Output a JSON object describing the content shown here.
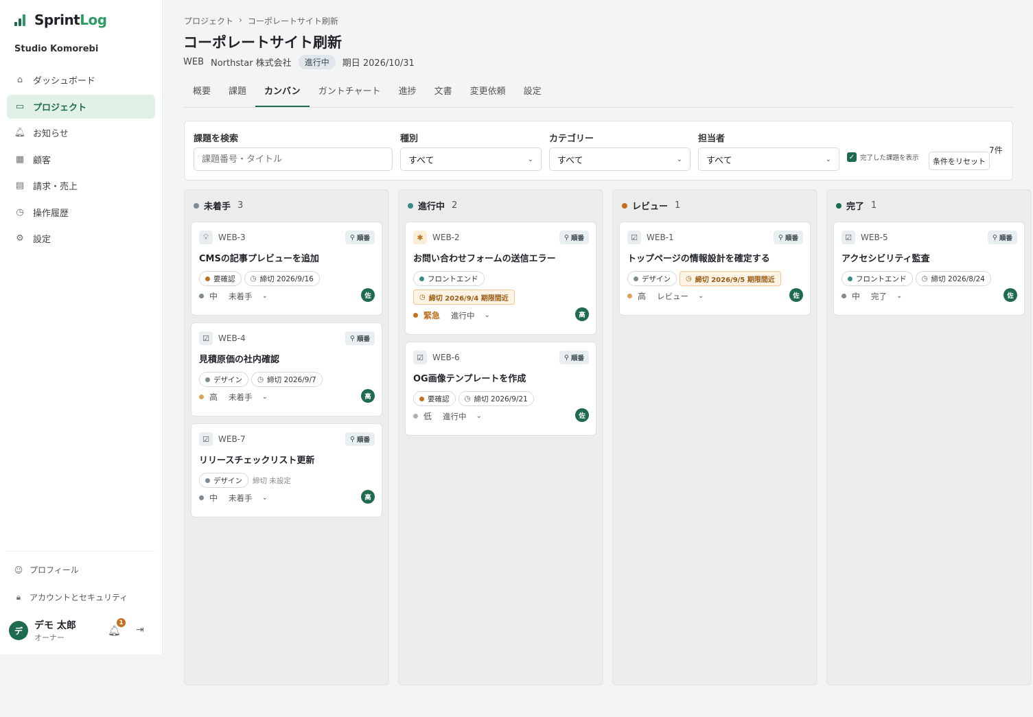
{
  "app": {
    "name_main": "Sprint",
    "name_accent": "Log",
    "org": "Studio Komorebi"
  },
  "colors": {
    "brand": "#1e6b4e",
    "warn": "#c0701f",
    "neutral": "#7d8a91"
  },
  "nav": [
    {
      "label": "ダッシュボード",
      "icon": "home-icon"
    },
    {
      "label": "プロジェクト",
      "icon": "folder-icon",
      "active": true
    },
    {
      "label": "お知らせ",
      "icon": "bell-icon"
    },
    {
      "label": "顧客",
      "icon": "building-icon"
    },
    {
      "label": "請求・売上",
      "icon": "receipt-icon"
    },
    {
      "label": "操作履歴",
      "icon": "clock-icon"
    },
    {
      "label": "設定",
      "icon": "gear-icon"
    }
  ],
  "sub_nav": {
    "profile": "プロフィール",
    "security": "アカウントとセキュリティ"
  },
  "user": {
    "initial": "デ",
    "name": "デモ 太郎",
    "role": "オーナー",
    "notifications": "1"
  },
  "breadcrumb": {
    "parent": "プロジェクト",
    "sep": "›",
    "current": "コーポレートサイト刷新"
  },
  "project": {
    "title": "コーポレートサイト刷新",
    "code": "WEB",
    "client": "Northstar 株式会社",
    "status": "進行中",
    "due": "期日 2026/10/31"
  },
  "tabs": [
    "概要",
    "課題",
    "カンバン",
    "ガントチャート",
    "進捗",
    "文書",
    "変更依頼",
    "設定"
  ],
  "filters": {
    "search_label": "課題を検索",
    "search_placeholder": "課題番号・タイトル",
    "type_label": "種別",
    "type_value": "すべて",
    "category_label": "カテゴリー",
    "category_value": "すべて",
    "assignee_label": "担当者",
    "assignee_value": "すべて",
    "show_done": "完了した課題を表示",
    "reset": "条件をリセット",
    "count": "7件"
  },
  "columns": [
    {
      "name": "未着手",
      "count": "3",
      "dot": "#7d8a91",
      "cards": [
        {
          "id": "WEB-3",
          "icon": "lightbulb-icon",
          "title": "CMSの記事プレビューを追加",
          "order": "順番",
          "tags": [
            {
              "label": "要確認",
              "dot": "#c0701f"
            },
            {
              "label": "締切 2026/9/16",
              "clock": true
            }
          ],
          "priority": "中",
          "pdot": "#7d8a91",
          "status": "未着手",
          "assignee": "佐"
        },
        {
          "id": "WEB-4",
          "icon": "check-square-icon",
          "title": "見積原価の社内確認",
          "tags": [
            {
              "label": "デザイン",
              "dot": "#7d8a91"
            },
            {
              "label": "締切 2026/9/7",
              "clock": true
            }
          ],
          "priority": "高",
          "pdot": "#e0a25a",
          "status": "未着手",
          "assignee": "高"
        },
        {
          "id": "WEB-7",
          "icon": "check-square-icon",
          "title": "リリースチェックリスト更新",
          "tags": [
            {
              "label": "デザイン",
              "dot": "#7d8a91"
            },
            {
              "label": "締切 未設定",
              "plain": true
            }
          ],
          "priority": "中",
          "pdot": "#7d8a91",
          "status": "未着手",
          "assignee": "高"
        }
      ]
    },
    {
      "name": "進行中",
      "count": "2",
      "dot": "#3b8a84",
      "cards": [
        {
          "id": "WEB-2",
          "icon": "bug-icon",
          "title": "お問い合わせフォームの送信エラー",
          "order": "順番",
          "tags": [
            {
              "label": "フロントエンド",
              "dot": "#3b8a84"
            }
          ],
          "warn": "締切 2026/9/4  期限間近",
          "priority": "緊急",
          "pdot": "#c0701f",
          "urgent": true,
          "status": "進行中",
          "assignee": "高"
        },
        {
          "id": "WEB-6",
          "icon": "check-square-icon",
          "title": "OG画像テンプレートを作成",
          "order": "順番",
          "tags": [
            {
              "label": "要確認",
              "dot": "#c0701f"
            },
            {
              "label": "締切 2026/9/21",
              "clock": true
            }
          ],
          "priority": "低",
          "pdot": "#aab2b7",
          "status": "進行中",
          "assignee": "佐"
        }
      ]
    },
    {
      "name": "レビュー",
      "count": "1",
      "dot": "#c0701f",
      "cards": [
        {
          "id": "WEB-1",
          "icon": "check-square-icon",
          "title": "トップページの情報設計を確定する",
          "order": "順番",
          "tags": [
            {
              "label": "デザイン",
              "dot": "#7d8a91"
            },
            {
              "label": "締切 2026/9/5  期限間近",
              "warn": true
            }
          ],
          "priority": "高",
          "pdot": "#e0a25a",
          "status": "レビュー",
          "assignee": "佐"
        }
      ]
    },
    {
      "name": "完了",
      "count": "1",
      "dot": "#1e6b4e",
      "cards": [
        {
          "id": "WEB-5",
          "icon": "check-square-icon",
          "title": "アクセシビリティ監査",
          "order": "順番",
          "tags": [
            {
              "label": "フロントエンド",
              "dot": "#3b8a84"
            },
            {
              "label": "締切 2026/8/24",
              "clock": true
            }
          ],
          "priority": "中",
          "pdot": "#7d8a91",
          "status": "完了",
          "assignee": "佐"
        }
      ]
    }
  ]
}
